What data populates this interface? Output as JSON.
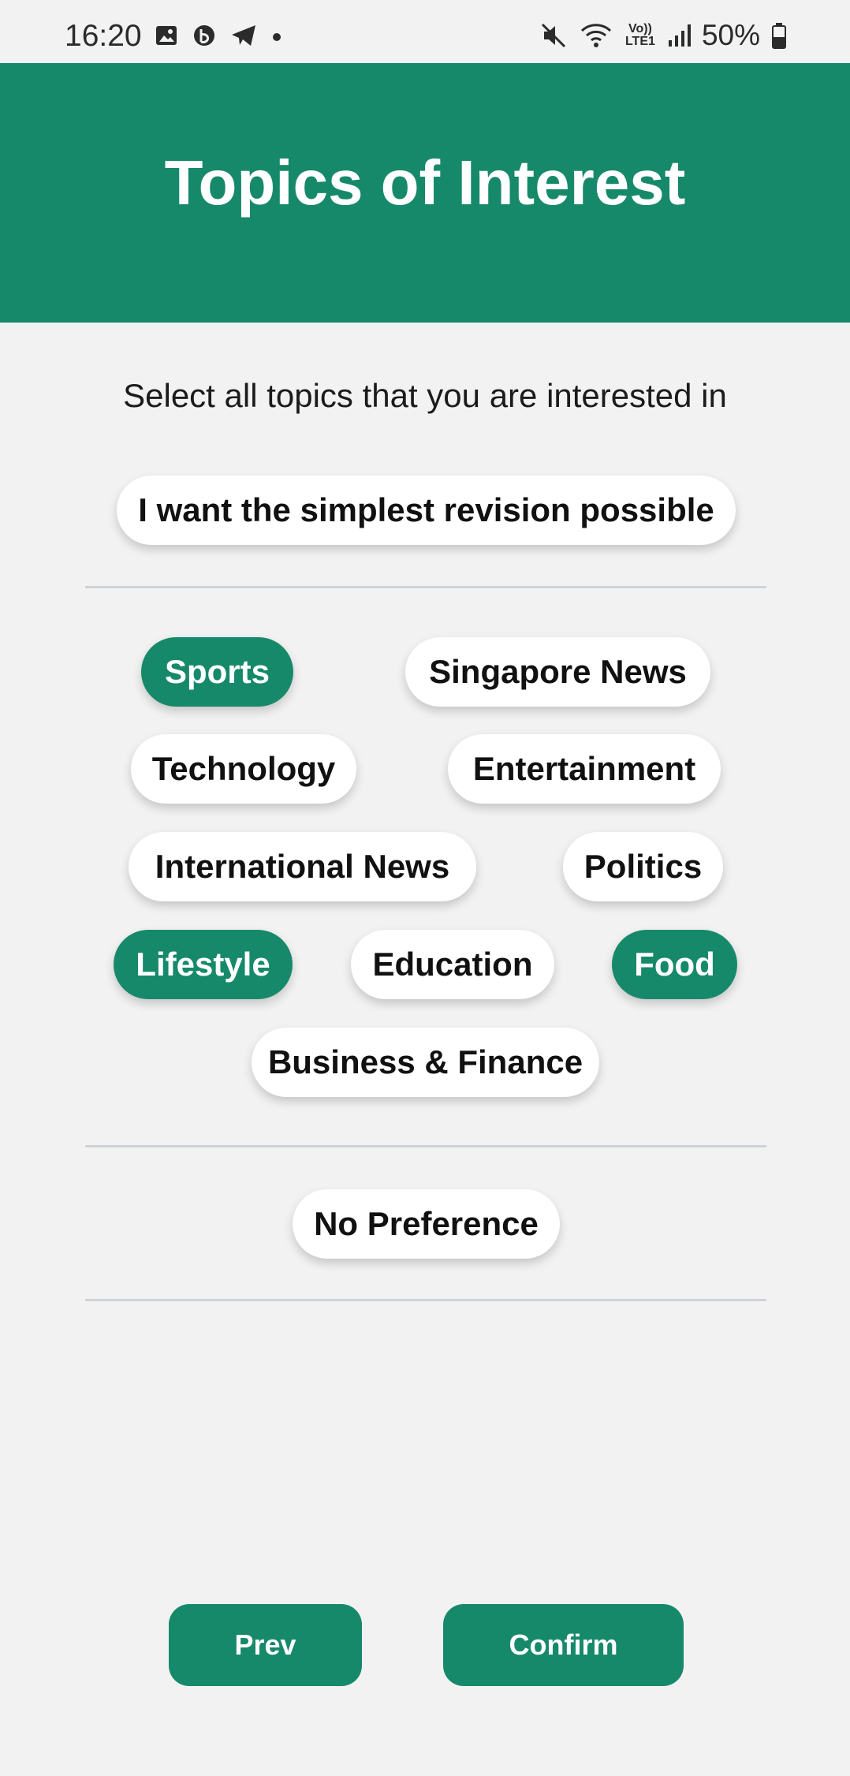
{
  "status_bar": {
    "time": "16:20",
    "battery": "50%",
    "left_icons": [
      "image-icon",
      "b-app-icon",
      "telegram-icon",
      "dot-icon"
    ],
    "right_icons": [
      "mute-icon",
      "wifi-icon",
      "volte-icon",
      "signal-icon",
      "battery-icon"
    ],
    "volte_label": "Vo)) LTE1"
  },
  "header": {
    "title": "Topics of Interest",
    "bg_color": "#17896b"
  },
  "subtitle": "Select all topics that you are interested in",
  "simplest_option": {
    "label": "I want the simplest revision possible",
    "selected": false
  },
  "topics": [
    {
      "label": "Sports",
      "selected": true
    },
    {
      "label": "Singapore News",
      "selected": false
    },
    {
      "label": "Technology",
      "selected": false
    },
    {
      "label": "Entertainment",
      "selected": false
    },
    {
      "label": "International News",
      "selected": false
    },
    {
      "label": "Politics",
      "selected": false
    },
    {
      "label": "Lifestyle",
      "selected": true
    },
    {
      "label": "Education",
      "selected": false
    },
    {
      "label": "Food",
      "selected": true
    },
    {
      "label": "Business & Finance",
      "selected": false
    }
  ],
  "no_preference": {
    "label": "No Preference",
    "selected": false
  },
  "buttons": {
    "prev": "Prev",
    "confirm": "Confirm"
  }
}
